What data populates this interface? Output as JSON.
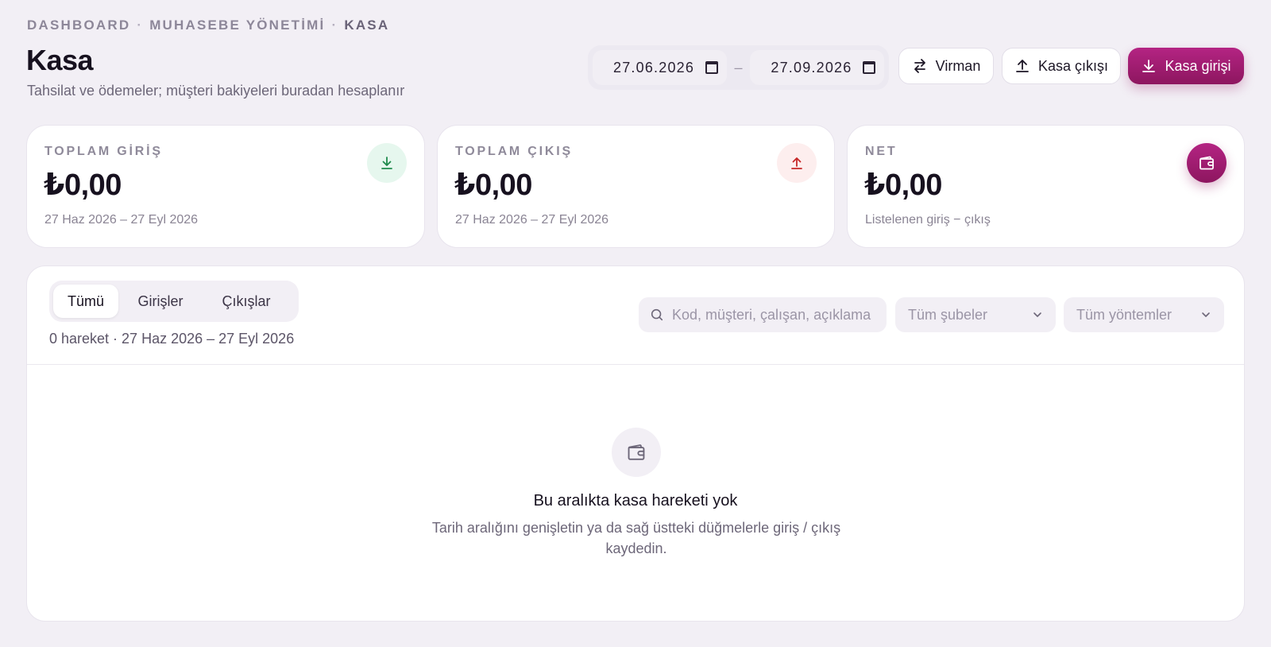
{
  "breadcrumb": {
    "items": [
      "DASHBOARD",
      "MUHASEBE YÖNETİMİ",
      "KASA"
    ],
    "separator": "·"
  },
  "header": {
    "title": "Kasa",
    "subtitle": "Tahsilat ve ödemeler; müşteri bakiyeleri buradan hesaplanır"
  },
  "date_range": {
    "start": "27.06.2026",
    "end": "27.09.2026",
    "separator": "–"
  },
  "actions": {
    "virman": "Virman",
    "cash_out": "Kasa çıkışı",
    "cash_in": "Kasa girişi"
  },
  "stats": [
    {
      "label": "TOPLAM GİRİŞ",
      "amount": "₺0,00",
      "period": "27 Haz 2026 – 27 Eyl 2026",
      "icon": "download-icon",
      "color": "#1f8a4c"
    },
    {
      "label": "TOPLAM ÇIKIŞ",
      "amount": "₺0,00",
      "period": "27 Haz 2026 – 27 Eyl 2026",
      "icon": "upload-icon",
      "color": "#c62828"
    },
    {
      "label": "NET",
      "amount": "₺0,00",
      "period": "Listelenen giriş − çıkış",
      "icon": "wallet-icon",
      "color": "#a01f74"
    }
  ],
  "panel": {
    "tabs": [
      "Tümü",
      "Girişler",
      "Çıkışlar"
    ],
    "active_tab": "Tümü",
    "count_line": "0 hareket · 27 Haz 2026 – 27 Eyl 2026",
    "search_placeholder": "Kod, müşteri, çalışan, açıklama",
    "branch_select": "Tüm şubeler",
    "method_select": "Tüm yöntemler",
    "empty_title": "Bu aralıkta kasa hareketi yok",
    "empty_desc": "Tarih aralığını genişletin ya da sağ üstteki düğmelerle giriş / çıkış kaydedin."
  },
  "colors": {
    "accent": "#a01f74",
    "background": "#f2eff5"
  }
}
